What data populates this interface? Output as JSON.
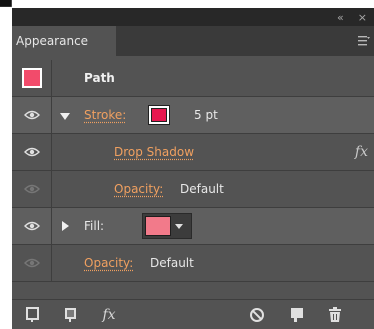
{
  "panel": {
    "tab_title": "Appearance",
    "object_type": "Path",
    "colors": {
      "object_swatch": "#f24b6b",
      "stroke_color": "#e8174f",
      "fill_color": "#f27a8a",
      "link_color": "#f0a060"
    }
  },
  "rows": {
    "stroke": {
      "label": "Stroke:",
      "weight": "5 pt"
    },
    "drop_shadow": {
      "label": "Drop Shadow",
      "fx": "fx"
    },
    "stroke_opacity": {
      "label": "Opacity:",
      "value": "Default"
    },
    "fill": {
      "label": "Fill:"
    },
    "fill_opacity": {
      "label": "Opacity:",
      "value": "Default"
    }
  },
  "bottom": {
    "fx_label": "fx"
  },
  "icons": [
    "collapse-icon",
    "close-icon",
    "panel-menu-icon",
    "eye-icon",
    "new-stroke-icon",
    "new-fill-icon",
    "fx-icon",
    "clear-icon",
    "duplicate-icon",
    "trash-icon"
  ]
}
